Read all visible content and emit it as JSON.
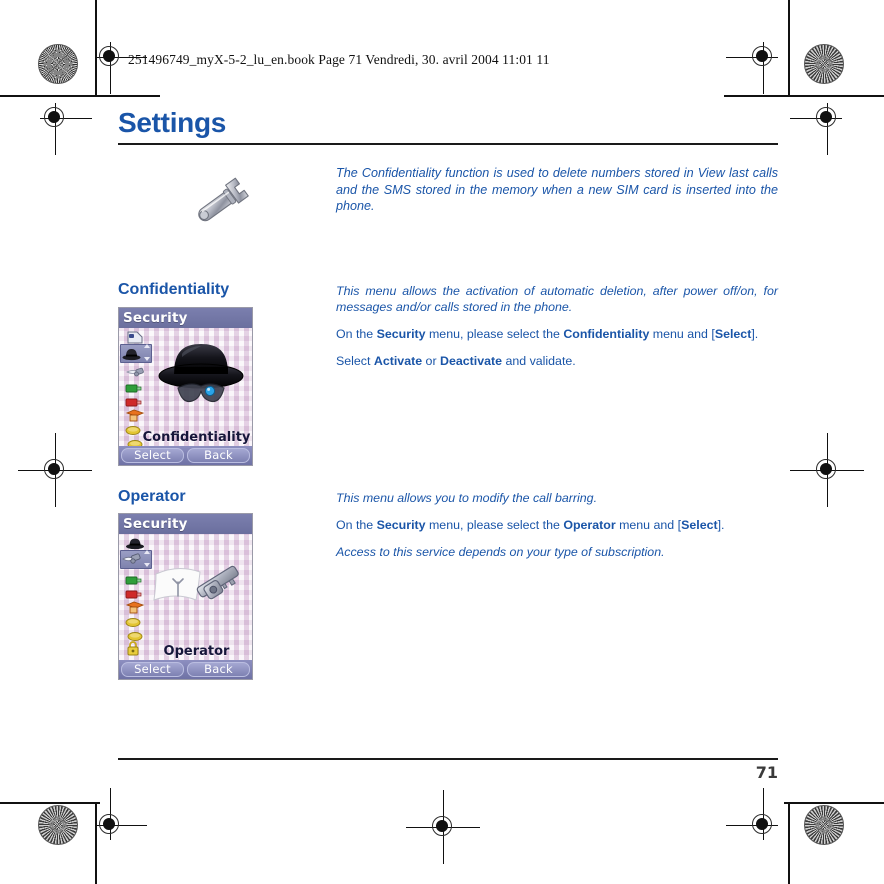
{
  "print_header": {
    "file_line": "251496749_myX-5-2_lu_en.book  Page 71  Vendredi, 30. avril 2004  11:01 11"
  },
  "page": {
    "title": "Settings",
    "number": "71",
    "title_color": "#1a55a8",
    "body_color": "#1a55a8"
  },
  "intro": {
    "icon": "wrench-icon",
    "text": "The Confidentiality function is used to delete numbers stored in View last calls and the SMS stored in the memory when a new SIM card is inserted into the phone."
  },
  "sections": [
    {
      "heading": "Confidentiality",
      "paragraphs": [
        {
          "style": "italic",
          "html": "This menu allows the activation of automatic deletion, after power off/on, for messages and/or calls stored in the phone."
        },
        {
          "style": "normal",
          "html": "On the <b>Security</b> menu, please select the <b>Confidentiality</b> menu and [<b>Select</b>]."
        },
        {
          "style": "normal",
          "html": "Select <b>Activate</b> or <b>Deactivate</b> and validate."
        }
      ],
      "screenshot": {
        "title": "Security",
        "label": "Confidentiality",
        "art": "black-hat-sunglasses",
        "softkey_left": "Select",
        "softkey_right": "Back",
        "icon_column": [
          "sim-card-icon",
          "hat-icon-selected",
          "key-banner-icon",
          "green-battery-icon",
          "red-battery-icon",
          "orange-book-icon",
          "yellow-oval-icon",
          "yellow-oval-icon"
        ]
      }
    },
    {
      "heading": "Operator",
      "paragraphs": [
        {
          "style": "italic",
          "html": "This menu allows you to modify the call barring."
        },
        {
          "style": "normal",
          "html": "On the <b>Security</b> menu, please select the <b>Operator</b> menu and [<b>Select</b>]."
        },
        {
          "style": "italic",
          "html": "Access to this service depends on your type of subscription."
        }
      ],
      "screenshot": {
        "title": "Security",
        "label": "Operator",
        "art": "key-with-banner",
        "softkey_left": "Select",
        "softkey_right": "Back",
        "icon_column": [
          "hat-icon",
          "key-banner-icon-selected",
          "green-battery-icon",
          "red-battery-icon",
          "orange-book-icon",
          "yellow-oval-icon",
          "yellow-oval-icon",
          "yellow-padlock-icon"
        ]
      }
    }
  ]
}
